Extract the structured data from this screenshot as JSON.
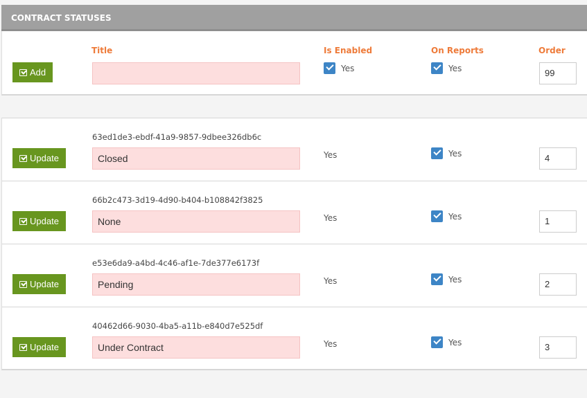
{
  "header": {
    "title": "CONTRACT STATUSES"
  },
  "add": {
    "button": "Add",
    "labels": {
      "title": "Title",
      "enabled": "Is Enabled",
      "reports": "On Reports",
      "order": "Order"
    },
    "title_value": "",
    "enabled_label": "Yes",
    "reports_label": "Yes",
    "order": "99"
  },
  "rows": [
    {
      "id": "63ed1de3-ebdf-41a9-9857-9dbee326db6c",
      "button": "Update",
      "title": "Closed",
      "enabled": "Yes",
      "reports": "Yes",
      "order": "4"
    },
    {
      "id": "66b2c473-3d19-4d90-b404-b108842f3825",
      "button": "Update",
      "title": "None",
      "enabled": "Yes",
      "reports": "Yes",
      "order": "1"
    },
    {
      "id": "e53e6da9-a4bd-4c46-af1e-7de377e6173f",
      "button": "Update",
      "title": "Pending",
      "enabled": "Yes",
      "reports": "Yes",
      "order": "2"
    },
    {
      "id": "40462d66-9030-4ba5-a11b-e840d7e525df",
      "button": "Update",
      "title": "Under Contract",
      "enabled": "Yes",
      "reports": "Yes",
      "order": "3"
    }
  ]
}
